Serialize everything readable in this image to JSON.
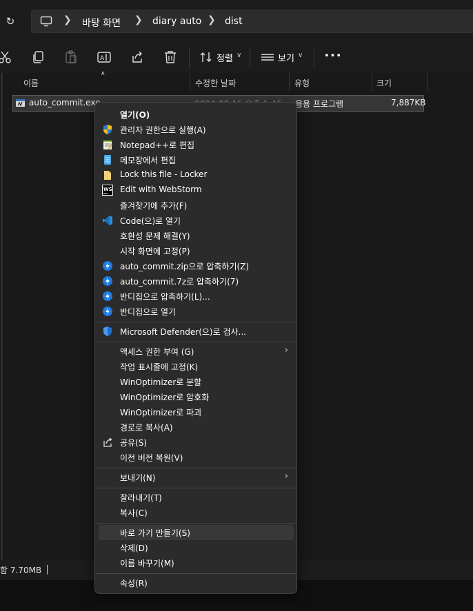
{
  "address": {
    "refresh_icon": "refresh-icon",
    "pc_icon": "this-pc-icon",
    "crumbs": [
      "바탕 화면",
      "diary auto",
      "dist"
    ]
  },
  "toolbar": {
    "sort_label": "정렬",
    "view_label": "보기",
    "more_label": "•••"
  },
  "columns": {
    "name": "이름",
    "modified": "수정한 날짜",
    "type": "유형",
    "size": "크기"
  },
  "file": {
    "name": "auto_commit.exe",
    "modified": "2024-08-15 오후 1:46",
    "type": "응용 프로그램",
    "size": "7,887KB"
  },
  "status": {
    "text": "함 7.70MB"
  },
  "menu": {
    "items": [
      {
        "label": "열기(O)",
        "icon": ""
      },
      {
        "label": "관리자 권한으로 실행(A)",
        "icon": "uac-shield-icon"
      },
      {
        "label": "Notepad++로 편집",
        "icon": "notepadpp-icon"
      },
      {
        "label": "메모장에서 편집",
        "icon": "notepad-icon"
      },
      {
        "label": "Lock this file - Locker",
        "icon": "locker-icon"
      },
      {
        "label": "Edit with WebStorm",
        "icon": "webstorm-icon"
      },
      {
        "label": "즐겨찾기에 추가(F)",
        "icon": ""
      },
      {
        "label": "Code(으)로 열기",
        "icon": "vscode-icon"
      },
      {
        "label": "호환성 문제 해결(Y)",
        "icon": ""
      },
      {
        "label": "시작 화면에 고정(P)",
        "icon": ""
      },
      {
        "label": "auto_commit.zip으로 압축하기(Z)",
        "icon": "bandizip-icon"
      },
      {
        "label": "auto_commit.7z로 압축하기(7)",
        "icon": "bandizip-icon"
      },
      {
        "label": "반디집으로 압축하기(L)...",
        "icon": "bandizip-icon"
      },
      {
        "label": "반디집으로 열기",
        "icon": "bandizip-icon"
      },
      {
        "label": "Microsoft Defender(으)로 검사...",
        "icon": "defender-icon"
      },
      {
        "label": "액세스 권한 부여 (G)",
        "icon": ""
      },
      {
        "label": "작업 표시줄에 고정(K)",
        "icon": ""
      },
      {
        "label": "WinOptimizer로 분할",
        "icon": ""
      },
      {
        "label": "WinOptimizer로 암호화",
        "icon": ""
      },
      {
        "label": "WinOptimizer로 파괴",
        "icon": ""
      },
      {
        "label": "경로로 복사(A)",
        "icon": ""
      },
      {
        "label": "공유(S)",
        "icon": "share-icon"
      },
      {
        "label": "이전 버전 복원(V)",
        "icon": ""
      },
      {
        "label": "보내기(N)",
        "icon": ""
      },
      {
        "label": "잘라내기(T)",
        "icon": ""
      },
      {
        "label": "복사(C)",
        "icon": ""
      },
      {
        "label": "바로 가기 만들기(S)",
        "icon": ""
      },
      {
        "label": "삭제(D)",
        "icon": ""
      },
      {
        "label": "이름 바꾸기(M)",
        "icon": ""
      },
      {
        "label": "속성(R)",
        "icon": ""
      }
    ]
  }
}
